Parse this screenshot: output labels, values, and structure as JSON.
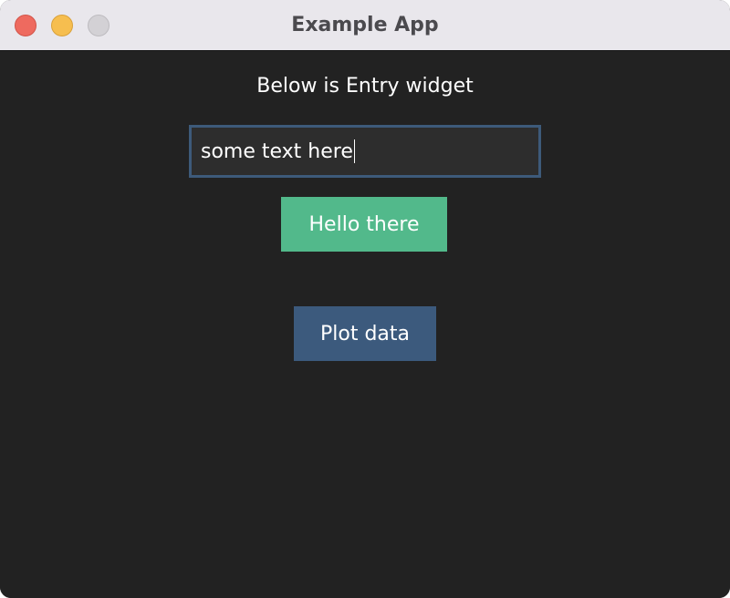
{
  "window": {
    "title": "Example App"
  },
  "content": {
    "label": "Below is Entry widget",
    "entry_value": "some text here",
    "hello_button_label": "Hello there",
    "plot_button_label": "Plot data"
  },
  "colors": {
    "background": "#222222",
    "hello_button": "#52b98b",
    "plot_button": "#3c5a7d",
    "entry_border": "#3d5a7a"
  }
}
